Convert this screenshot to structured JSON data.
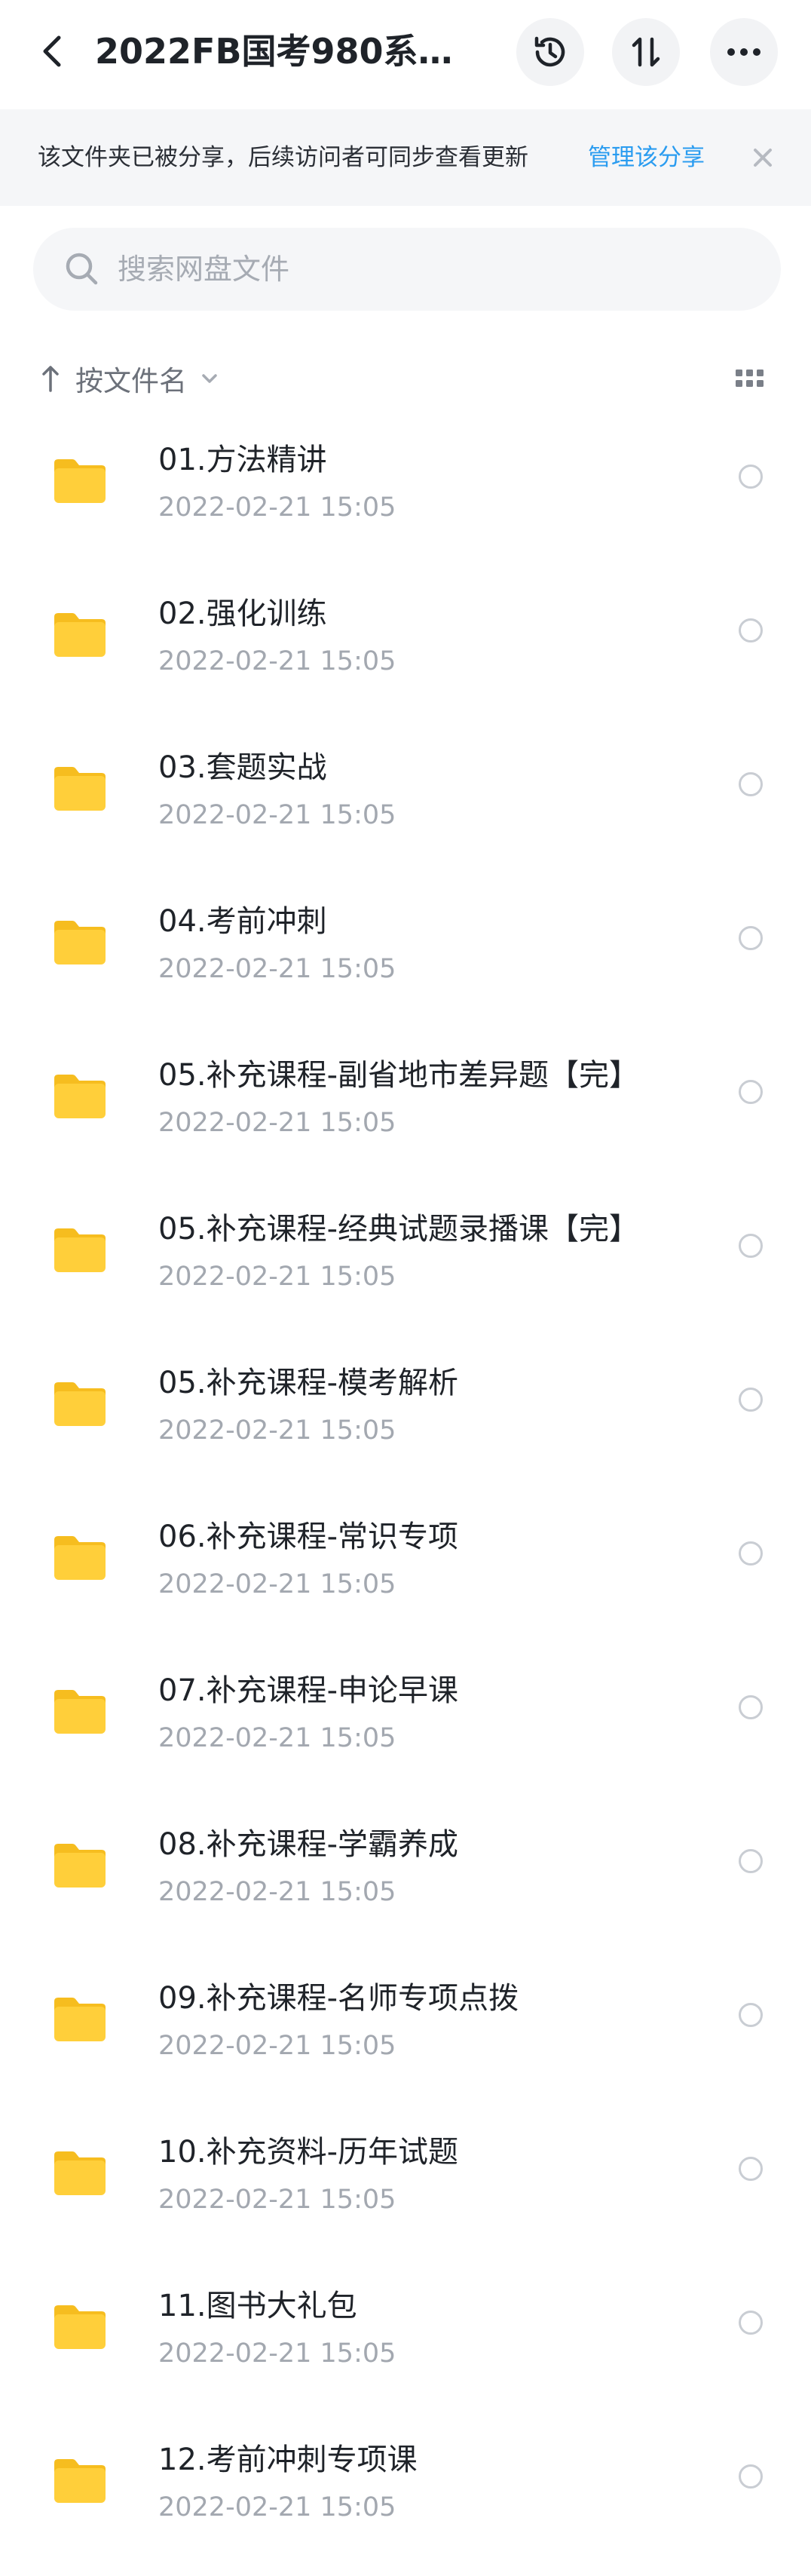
{
  "header": {
    "title": "2022FB国考980系…",
    "back_icon": "chevron-left-icon",
    "history_icon": "history-icon",
    "sort_icon": "transfer-sort-icon",
    "more_icon": "more-horizontal-icon"
  },
  "banner": {
    "text": "该文件夹已被分享，后续访问者可同步查看更新",
    "link": "管理该分享",
    "close_icon": "close-icon",
    "link_color": "#2a9cf0"
  },
  "search": {
    "placeholder": "搜索网盘文件",
    "value": "",
    "icon": "search-icon"
  },
  "sortbar": {
    "label": "按文件名",
    "arrow_icon": "arrow-up-icon",
    "chevron_icon": "chevron-down-icon",
    "view_icon": "grid-view-icon"
  },
  "colors": {
    "folder": "#ffcf3a",
    "folder_tab": "#f6bd1f",
    "date": "#a3a8b0",
    "text": "#1f2329"
  },
  "files": [
    {
      "name": "01.方法精讲",
      "date": "2022-02-21  15:05",
      "icon": "folder-icon"
    },
    {
      "name": "02.强化训练",
      "date": "2022-02-21  15:05",
      "icon": "folder-icon"
    },
    {
      "name": "03.套题实战",
      "date": "2022-02-21  15:05",
      "icon": "folder-icon"
    },
    {
      "name": "04.考前冲刺",
      "date": "2022-02-21  15:05",
      "icon": "folder-icon"
    },
    {
      "name": "05.补充课程-副省地市差异题【完】",
      "date": "2022-02-21  15:05",
      "icon": "folder-icon"
    },
    {
      "name": "05.补充课程-经典试题录播课【完】",
      "date": "2022-02-21  15:05",
      "icon": "folder-icon"
    },
    {
      "name": "05.补充课程-模考解析",
      "date": "2022-02-21  15:05",
      "icon": "folder-icon"
    },
    {
      "name": "06.补充课程-常识专项",
      "date": "2022-02-21  15:05",
      "icon": "folder-icon"
    },
    {
      "name": "07.补充课程-申论早课",
      "date": "2022-02-21  15:05",
      "icon": "folder-icon"
    },
    {
      "name": "08.补充课程-学霸养成",
      "date": "2022-02-21  15:05",
      "icon": "folder-icon"
    },
    {
      "name": "09.补充课程-名师专项点拨",
      "date": "2022-02-21  15:05",
      "icon": "folder-icon"
    },
    {
      "name": "10.补充资料-历年试题",
      "date": "2022-02-21  15:05",
      "icon": "folder-icon"
    },
    {
      "name": "11.图书大礼包",
      "date": "2022-02-21  15:05",
      "icon": "folder-icon"
    },
    {
      "name": "12.考前冲刺专项课",
      "date": "2022-02-21  15:05",
      "icon": "folder-icon"
    }
  ]
}
